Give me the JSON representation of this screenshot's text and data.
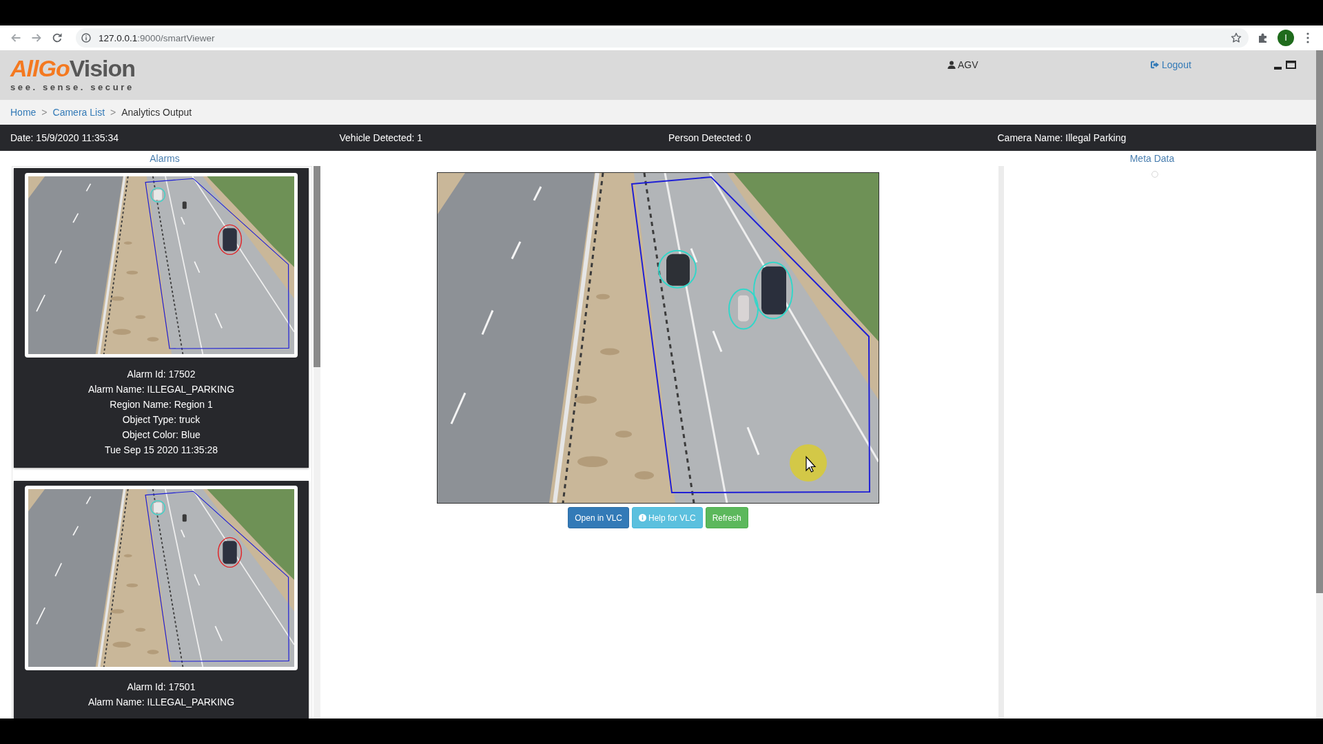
{
  "browser": {
    "url_host": "127.0.0.1",
    "url_rest": ":9000/smartViewer",
    "profile_initial": "I"
  },
  "header": {
    "logo": {
      "brand": "AllGoVision",
      "tagline": "see. sense. secure"
    },
    "user": "AGV",
    "logout": "Logout"
  },
  "breadcrumb": {
    "separator": ">",
    "items": [
      {
        "label": "Home",
        "kind": "link"
      },
      {
        "label": "Camera List",
        "kind": "link"
      },
      {
        "label": "Analytics Output",
        "kind": "current"
      }
    ]
  },
  "info_bar": [
    "Date: 15/9/2020 11:35:34",
    "Vehicle Detected: 1",
    "Person Detected: 0",
    "Camera Name: Illegal Parking"
  ],
  "alarms": {
    "title": "Alarms",
    "cards": [
      {
        "lines": [
          "Alarm Id: 17502",
          "Alarm Name: ILLEGAL_PARKING",
          "Region Name: Region 1",
          "Object Type: truck",
          "Object Color: Blue",
          "Tue Sep 15 2020 11:35:28"
        ]
      },
      {
        "lines": [
          "Alarm Id: 17501",
          "Alarm Name: ILLEGAL_PARKING"
        ]
      }
    ]
  },
  "player": {
    "buttons": [
      {
        "label": "Open in VLC",
        "kind": "primary"
      },
      {
        "label": "Help for VLC",
        "kind": "info"
      },
      {
        "label": "Refresh",
        "kind": "success"
      }
    ]
  },
  "meta_data": {
    "title": "Meta Data"
  }
}
